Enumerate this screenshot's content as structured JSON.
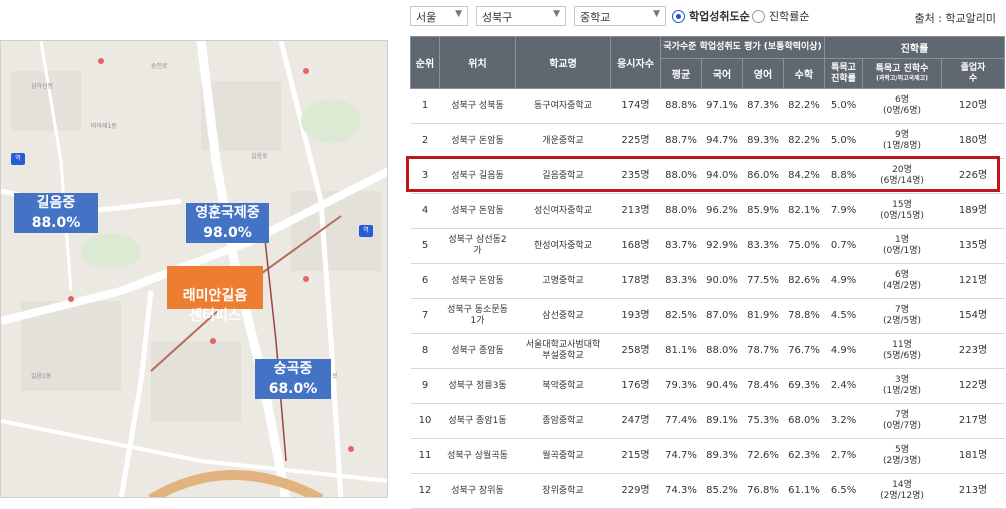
{
  "map": {
    "labels": [
      {
        "name": "길음중",
        "rate": "88.0%"
      },
      {
        "name": "영훈국제중",
        "rate": "98.0%"
      },
      {
        "name": "래미안길음\n센터피스"
      },
      {
        "name": "숭곡중",
        "rate": "68.0%"
      }
    ],
    "small_texts": [
      "숭인로",
      "삼각산동",
      "미아제1동",
      "길음로",
      "정릉동",
      "성북구",
      "길음1동",
      "종암로",
      "미아역",
      "화계사"
    ]
  },
  "filters": {
    "city": "서울",
    "district": "성북구",
    "level": "중학교",
    "sort_options": [
      "학업성취도순",
      "진학률순"
    ],
    "source": "출처 : 학교알리미"
  },
  "table": {
    "group_headers": {
      "achievement": "국가수준 학업성취도 평가 (보통학력이상)",
      "advancement": "진학률"
    },
    "headers": {
      "rank": "순위",
      "location": "위치",
      "school": "학교명",
      "applicants": "응시자수",
      "avg": "평균",
      "korean": "국어",
      "english": "영어",
      "math": "수학",
      "special_rate": "특목고\n진학률",
      "special_count": "특목고 진학수",
      "special_count_sub": "(과학고/외고국제고)",
      "graduates": "졸업자\n수"
    },
    "rows": [
      {
        "rank": "1",
        "location": "성북구 성북동",
        "school": "동구여자중학교",
        "applicants": "174명",
        "avg": "88.8%",
        "korean": "97.1%",
        "english": "87.3%",
        "math": "82.2%",
        "rate": "5.0%",
        "count": "6명",
        "count_sub": "(0명/6명)",
        "grads": "120명"
      },
      {
        "rank": "2",
        "location": "성북구 돈암동",
        "school": "개운중학교",
        "applicants": "225명",
        "avg": "88.7%",
        "korean": "94.7%",
        "english": "89.3%",
        "math": "82.2%",
        "rate": "5.0%",
        "count": "9명",
        "count_sub": "(1명/8명)",
        "grads": "180명"
      },
      {
        "rank": "3",
        "location": "성북구 길음동",
        "school": "길음중학교",
        "applicants": "235명",
        "avg": "88.0%",
        "korean": "94.0%",
        "english": "86.0%",
        "math": "84.2%",
        "rate": "8.8%",
        "count": "20명",
        "count_sub": "(6명/14명)",
        "grads": "226명"
      },
      {
        "rank": "4",
        "location": "성북구 돈암동",
        "school": "성신여자중학교",
        "applicants": "213명",
        "avg": "88.0%",
        "korean": "96.2%",
        "english": "85.9%",
        "math": "82.1%",
        "rate": "7.9%",
        "count": "15명",
        "count_sub": "(0명/15명)",
        "grads": "189명"
      },
      {
        "rank": "5",
        "location": "성북구 삼선동2\n가",
        "school": "한성여자중학교",
        "applicants": "168명",
        "avg": "83.7%",
        "korean": "92.9%",
        "english": "83.3%",
        "math": "75.0%",
        "rate": "0.7%",
        "count": "1명",
        "count_sub": "(0명/1명)",
        "grads": "135명"
      },
      {
        "rank": "6",
        "location": "성북구 돈암동",
        "school": "고명중학교",
        "applicants": "178명",
        "avg": "83.3%",
        "korean": "90.0%",
        "english": "77.5%",
        "math": "82.6%",
        "rate": "4.9%",
        "count": "6명",
        "count_sub": "(4명/2명)",
        "grads": "121명"
      },
      {
        "rank": "7",
        "location": "성북구 동소문동\n1가",
        "school": "삼선중학교",
        "applicants": "193명",
        "avg": "82.5%",
        "korean": "87.0%",
        "english": "81.9%",
        "math": "78.8%",
        "rate": "4.5%",
        "count": "7명",
        "count_sub": "(2명/5명)",
        "grads": "154명"
      },
      {
        "rank": "8",
        "location": "성북구 종암동",
        "school": "서울대학교사범대학\n부설중학교",
        "applicants": "258명",
        "avg": "81.1%",
        "korean": "88.0%",
        "english": "78.7%",
        "math": "76.7%",
        "rate": "4.9%",
        "count": "11명",
        "count_sub": "(5명/6명)",
        "grads": "223명"
      },
      {
        "rank": "9",
        "location": "성북구 정릉3동",
        "school": "북악중학교",
        "applicants": "176명",
        "avg": "79.3%",
        "korean": "90.4%",
        "english": "78.4%",
        "math": "69.3%",
        "rate": "2.4%",
        "count": "3명",
        "count_sub": "(1명/2명)",
        "grads": "122명"
      },
      {
        "rank": "10",
        "location": "성북구 종암1동",
        "school": "종암중학교",
        "applicants": "247명",
        "avg": "77.4%",
        "korean": "89.1%",
        "english": "75.3%",
        "math": "68.0%",
        "rate": "3.2%",
        "count": "7명",
        "count_sub": "(0명/7명)",
        "grads": "217명"
      },
      {
        "rank": "11",
        "location": "성북구 상월곡동",
        "school": "월곡중학교",
        "applicants": "215명",
        "avg": "74.7%",
        "korean": "89.3%",
        "english": "72.6%",
        "math": "62.3%",
        "rate": "2.7%",
        "count": "5명",
        "count_sub": "(2명/3명)",
        "grads": "181명"
      },
      {
        "rank": "12",
        "location": "성북구 장위동",
        "school": "장위중학교",
        "applicants": "229명",
        "avg": "74.3%",
        "korean": "85.2%",
        "english": "76.8%",
        "math": "61.1%",
        "rate": "6.5%",
        "count": "14명",
        "count_sub": "(2명/12명)",
        "grads": "213명"
      }
    ]
  }
}
